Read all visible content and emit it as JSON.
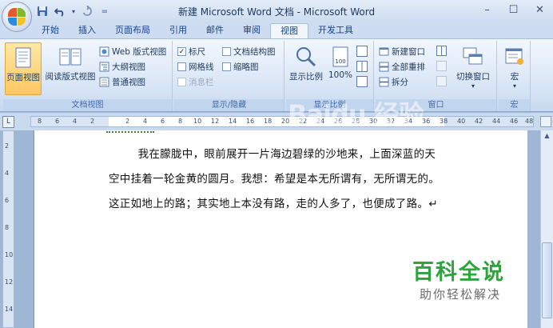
{
  "window": {
    "title": "新建 Microsoft Word 文档 - Microsoft Word",
    "minimize_glyph": "–",
    "maximize_glyph": "☐",
    "close_glyph": "✕"
  },
  "quick_access": {
    "save_icon": "save-icon",
    "undo_icon": "undo-icon",
    "redo_icon": "redo-icon",
    "customize_glyph": "="
  },
  "tabs": [
    {
      "label": "开始"
    },
    {
      "label": "插入"
    },
    {
      "label": "页面布局"
    },
    {
      "label": "引用"
    },
    {
      "label": "邮件"
    },
    {
      "label": "审阅"
    },
    {
      "label": "视图",
      "active": true
    },
    {
      "label": "开发工具"
    }
  ],
  "ribbon": {
    "doc_views": {
      "group_label": "文档视图",
      "print_layout": "页面视图",
      "full_screen_reading": "阅读版式视图",
      "web_layout": "Web 版式视图",
      "outline": "大纲视图",
      "draft": "普通视图"
    },
    "show_hide": {
      "group_label": "显示/隐藏",
      "ruler": "标尺",
      "ruler_checked": true,
      "gridlines": "网格线",
      "gridlines_checked": false,
      "message_bar": "消息栏",
      "message_bar_checked": false,
      "doc_map": "文档结构图",
      "doc_map_checked": false,
      "thumbnails": "缩略图",
      "thumbnails_checked": false
    },
    "zoom": {
      "group_label": "显示比例",
      "zoom_button": "显示比例",
      "hundred": "100%",
      "hundred_icon_text": "100"
    },
    "window": {
      "group_label": "窗口",
      "new_window": "新建窗口",
      "arrange_all": "全部重排",
      "split": "拆分",
      "switch_windows": "切换窗口"
    },
    "macros": {
      "group_label": "宏",
      "macros_button": "宏"
    }
  },
  "ruler": {
    "corner_glyph": "L",
    "ticks": [
      "8",
      "6",
      "4",
      "2",
      "2",
      "4",
      "6",
      "8",
      "10",
      "12",
      "14",
      "16",
      "18",
      "20",
      "22",
      "24",
      "26",
      "28",
      "30",
      "32",
      "34",
      "36",
      "38",
      "40",
      "42",
      "44",
      "46",
      "48"
    ]
  },
  "vruler": {
    "ticks": [
      "2",
      "4",
      "6",
      "8",
      "10",
      "12",
      "14"
    ]
  },
  "document": {
    "lines": [
      "　　我在朦胧中，眼前展开一片海边碧绿的沙地来，上面深蓝的天",
      "空中挂着一轮金黄的圆月。我想：希望是本无所谓有，无所谓无的。",
      "这正如地上的路；其实地上本没有路，走的人多了，也便成了路。↵"
    ]
  },
  "watermarks": {
    "baidu": "Baidu 经验",
    "baike": "百科全说",
    "baike_sub": "助你轻松解决"
  },
  "colors": {
    "accent": "#15428b",
    "ribbon_bg": "#d7e4f5",
    "selected_button": "#ffc861",
    "baike_green": "#2fa33d"
  }
}
